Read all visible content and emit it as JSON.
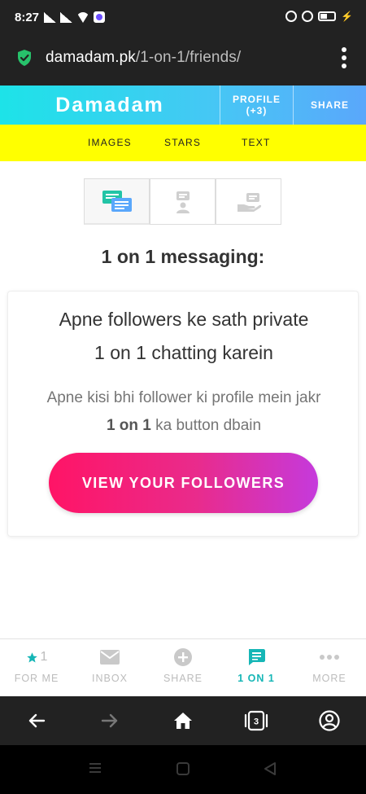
{
  "status": {
    "time": "8:27"
  },
  "url_bar": {
    "domain": "damadam.pk",
    "path": "/1-on-1/friends/"
  },
  "header": {
    "brand": "Damadam",
    "profile_label": "PROFILE",
    "profile_count": "(+3)",
    "share_label": "SHARE",
    "gradient": [
      "#1de3e8",
      "#5aa7fb"
    ]
  },
  "sub_nav": {
    "items": [
      "IMAGES",
      "STARS",
      "TEXT"
    ],
    "background": "#ffff00"
  },
  "tabs": {
    "icons": [
      "chat-icon",
      "upload-person-icon",
      "hand-give-icon"
    ]
  },
  "main": {
    "heading": "1 on 1 messaging:",
    "card_line1": "Apne followers ke sath private",
    "card_line2": "1 on 1 chatting karein",
    "desc_line1": "Apne kisi bhi follower ki profile mein jakr",
    "desc_bold": "1 on 1",
    "desc_rest": " ka button dbain",
    "cta_label": "VIEW YOUR FOLLOWERS"
  },
  "bottom_nav": {
    "items": [
      {
        "label": "FOR ME",
        "icon": "star-icon",
        "count": "1"
      },
      {
        "label": "INBOX",
        "icon": "envelope-icon"
      },
      {
        "label": "SHARE",
        "icon": "plus-circle-icon"
      },
      {
        "label": "1 ON 1",
        "icon": "chat-bubble-icon",
        "active": true
      },
      {
        "label": "MORE",
        "icon": "more-dots-icon"
      }
    ],
    "active_color": "#16b6b6"
  },
  "browser_toolbar": {
    "tab_count": "3"
  }
}
